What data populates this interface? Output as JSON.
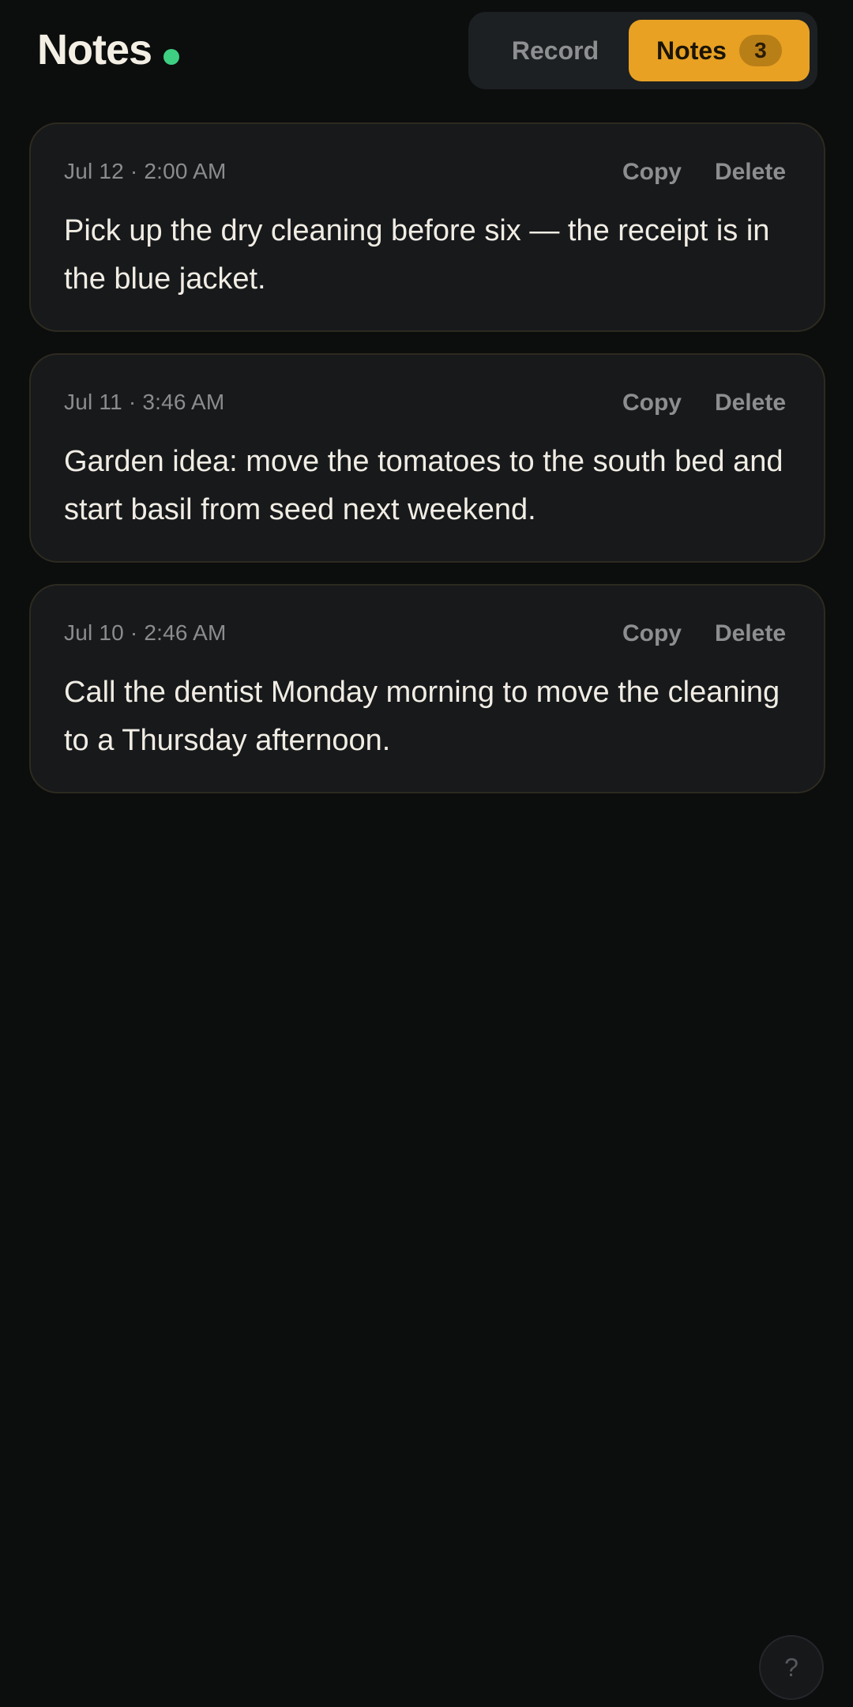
{
  "header": {
    "title": "Notes",
    "status_color": "#3ecf83"
  },
  "segmented": {
    "record_label": "Record",
    "notes_label": "Notes",
    "notes_count": "3",
    "active": "Notes",
    "accent_color": "#e8a123"
  },
  "notes": [
    {
      "time": "Jul 12 · 2:00 AM",
      "copy_label": "Copy",
      "delete_label": "Delete",
      "text": "Pick up the dry cleaning before six — the receipt is in the blue jacket."
    },
    {
      "time": "Jul 11 · 3:46 AM",
      "copy_label": "Copy",
      "delete_label": "Delete",
      "text": "Garden idea: move the tomatoes to the south bed and start basil from seed next weekend."
    },
    {
      "time": "Jul 10 · 2:46 AM",
      "copy_label": "Copy",
      "delete_label": "Delete",
      "text": "Call the dentist Monday morning to move the cleaning to a Thursday afternoon."
    }
  ],
  "help": {
    "label": "?",
    "icon": "help-icon"
  }
}
